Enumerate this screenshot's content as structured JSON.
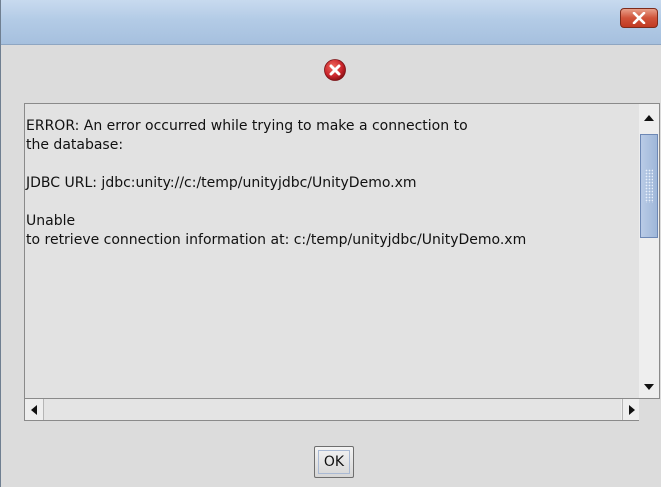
{
  "window": {
    "close_icon": "close-icon"
  },
  "dialog": {
    "icon": "error-icon",
    "message_lines": [
      "ERROR: An error occurred while trying to make a connection to",
      "the database:",
      "",
      "JDBC URL: jdbc:unity://c:/temp/unityjdbc/UnityDemo.xm",
      "",
      "Unable",
      "to retrieve connection information at: c:/temp/unityjdbc/UnityDemo.xm"
    ],
    "ok_label": "OK"
  },
  "colors": {
    "title_bar": "#b3cbe6",
    "close_button": "#c13a22",
    "error_icon": "#c8232a",
    "scroll_thumb": "#a9bfe0"
  }
}
